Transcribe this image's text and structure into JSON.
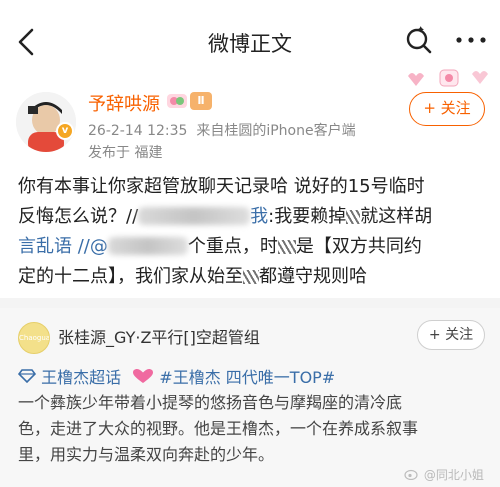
{
  "header": {
    "title": "微博正文"
  },
  "post": {
    "username": "予辞哄源",
    "badge_level": "Ⅱ",
    "verified_mark": "v",
    "time": "26-2-14 12:35",
    "source_prefix": "来自",
    "source_name": "桂圆的iPhone客户端",
    "location": "发布于 福建",
    "follow_label": "+ 关注",
    "lines": [
      {
        "a": "你有本事让你家超管放聊天记录哈 说好的15号临时"
      },
      {
        "a": "反悔怎么说？//",
        "b": "我",
        "c": ":我要赖掉",
        "d": "就这样胡"
      },
      {
        "a": "言乱语 //@",
        "b": "个重点，时",
        "c": "是【双方共同约"
      },
      {
        "a": "定的十二点】，我们家从始至",
        "b": "都遵守规则哈"
      }
    ]
  },
  "quoted": {
    "avatar_text": "Chaoguan",
    "name": "张桂源_GY·Z平行[]空超管组",
    "follow_label": "+ 关注",
    "topic1": "王橹杰超话",
    "topic2": "#王橹杰 四代唯一TOP#",
    "lines": [
      "一个彝族少年带着小提琴的悠扬音色与摩羯座的清冷底",
      "色，走进了大众的视野。他是王橹杰，一个在养成系叙事",
      "里，用实力与温柔双向奔赴的少年。"
    ],
    "watermark": "@同北小姐"
  },
  "colors": {
    "accent": "#f86100",
    "link": "#3a6ea8"
  }
}
